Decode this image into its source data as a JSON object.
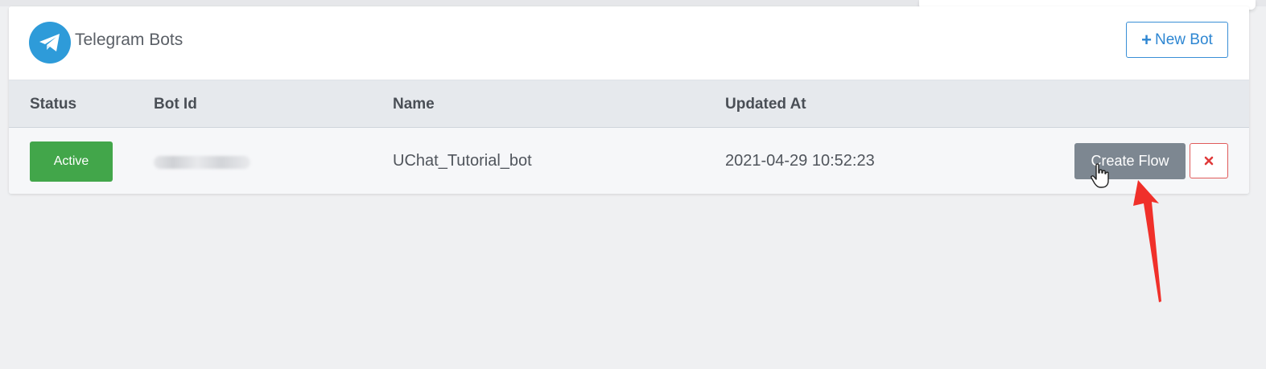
{
  "card": {
    "title": "Telegram Bots",
    "logo_icon": "telegram-icon",
    "new_bot_label": "New Bot",
    "new_bot_icon": "plus-icon"
  },
  "table": {
    "columns": [
      "Status",
      "Bot Id",
      "Name",
      "Updated At"
    ],
    "rows": [
      {
        "status": "Active",
        "bot_id": "",
        "name": "UChat_Tutorial_bot",
        "updated_at": "2021-04-29 10:52:23",
        "create_flow_label": "Create Flow",
        "delete_icon": "close-icon"
      }
    ]
  },
  "colors": {
    "accent": "#2d86d2",
    "status_active": "#42a64a",
    "create_flow_bg": "#7d8791",
    "danger": "#e05a5a",
    "annotation_arrow": "#f0302a"
  }
}
